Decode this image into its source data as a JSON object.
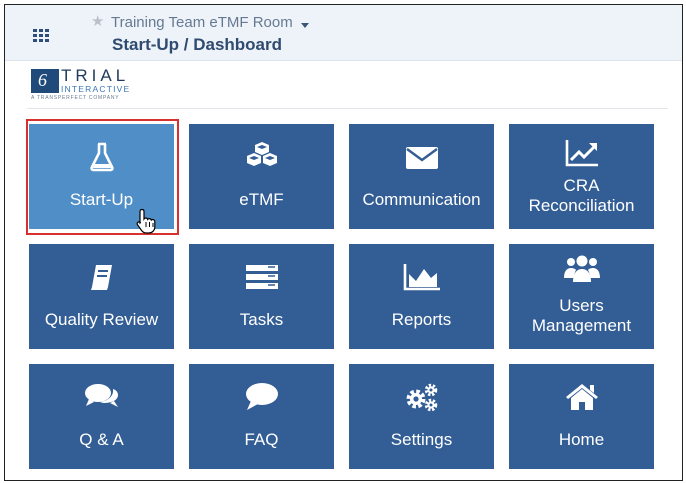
{
  "header": {
    "room_title": "Training Team eTMF Room",
    "breadcrumb": "Start-Up / Dashboard"
  },
  "logo": {
    "mark": "6",
    "title": "TRIAL",
    "subtitle": "INTERACTIVE",
    "company": "A TRANSPERFECT COMPANY"
  },
  "tiles": [
    {
      "label": "Start-Up",
      "icon": "flask-icon",
      "active": true
    },
    {
      "label": "eTMF",
      "icon": "cubes-icon"
    },
    {
      "label": "Communication",
      "icon": "envelope-icon"
    },
    {
      "label_line1": "CRA",
      "label_line2": "Reconciliation",
      "icon": "trend-chart-icon"
    },
    {
      "label": "Quality Review",
      "icon": "book-icon"
    },
    {
      "label": "Tasks",
      "icon": "tasks-icon"
    },
    {
      "label": "Reports",
      "icon": "area-chart-icon"
    },
    {
      "label_line1": "Users",
      "label_line2": "Management",
      "icon": "users-icon"
    },
    {
      "label": "Q & A",
      "icon": "comments-icon"
    },
    {
      "label": "FAQ",
      "icon": "comment-icon"
    },
    {
      "label": "Settings",
      "icon": "gears-icon"
    },
    {
      "label": "Home",
      "icon": "home-icon"
    }
  ],
  "colors": {
    "tile": "#325d95",
    "tile_active": "#4f8ec6",
    "highlight": "#d7302f",
    "topbar": "#eef3f9"
  }
}
